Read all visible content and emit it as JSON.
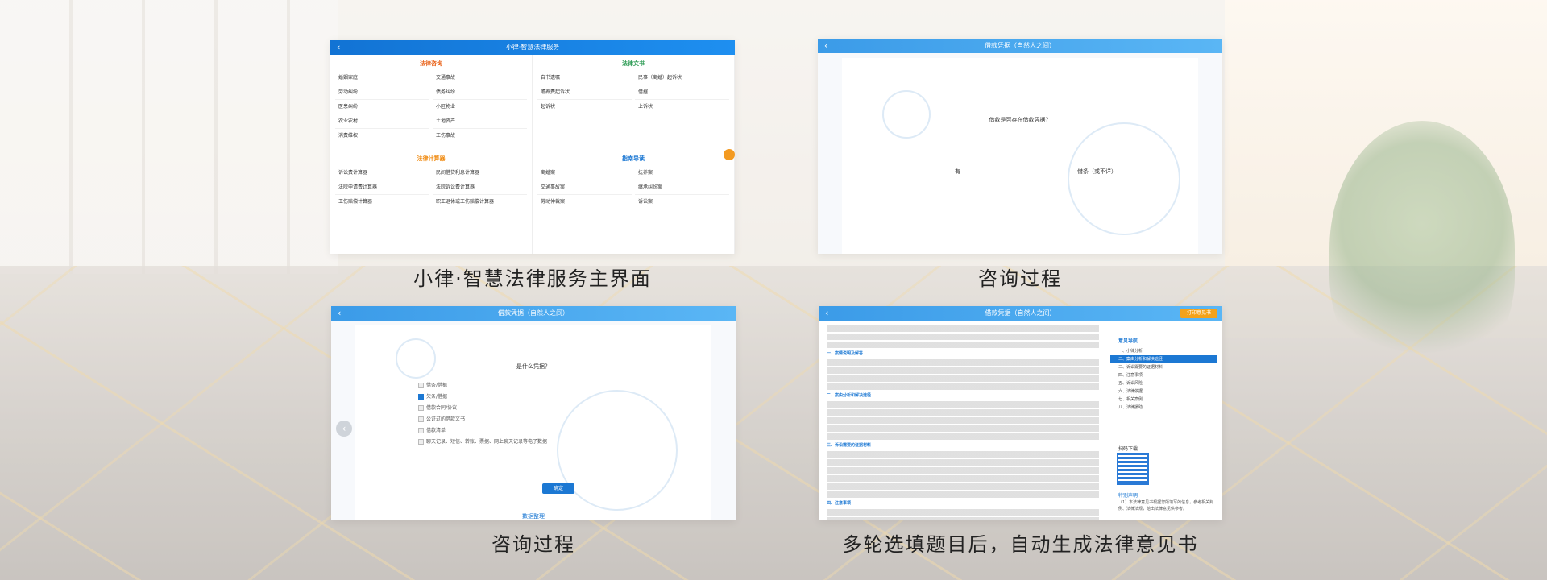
{
  "captions": {
    "p1": "小律·智慧法律服务主界面",
    "p2": "咨询过程",
    "p3": "咨询过程",
    "p4": "多轮选填题目后，自动生成法律意见书"
  },
  "panel1": {
    "title": "小律·智慧法律服务",
    "sections": {
      "consult": {
        "title": "法律咨询",
        "items": [
          "婚姻家庭",
          "交通事故",
          "劳动纠纷",
          "债务纠纷",
          "医患纠纷",
          "小区物业",
          "农业农村",
          "土地资产",
          "消费维权",
          "工伤事故"
        ]
      },
      "docs": {
        "title": "法律文书",
        "items": [
          "自书遗嘱",
          "民事（离婚）起诉状",
          "赡养费起诉状",
          "借据",
          "起诉状",
          "上诉状"
        ]
      },
      "calc": {
        "title": "法律计算器",
        "items": [
          "诉讼费计算器",
          "民间借贷利息计算器",
          "法院申请费计算器",
          "法院诉讼费计算器",
          "工伤赔偿计算器",
          "职工退休或工伤赔偿计算器"
        ]
      },
      "guide": {
        "title": "指南导读",
        "items": [
          "离婚案",
          "抚养案",
          "交通事故案",
          "继承纠纷案",
          "劳动仲裁案",
          "诉讼案"
        ]
      }
    }
  },
  "panel2": {
    "title": "借款凭据（自然人之间）",
    "question": "借款是否存在借款凭据？",
    "option_yes": "有",
    "option_no": "借条（或不详）"
  },
  "panel3": {
    "title": "借款凭据（自然人之间）",
    "question": "是什么凭据？",
    "options": [
      {
        "label": "借条/借据",
        "checked": false
      },
      {
        "label": "欠条/借据",
        "checked": true
      },
      {
        "label": "借款合同/协议",
        "checked": false
      },
      {
        "label": "公证过的借款文书",
        "checked": false
      },
      {
        "label": "借款清单",
        "checked": false
      },
      {
        "label": "聊天记录、短信、转账、票据、网上聊天记录等电子数据",
        "checked": false
      }
    ],
    "confirm": "确定",
    "footer": "数据整理"
  },
  "panel4": {
    "title": "借款凭据（自然人之间）",
    "print_label": "打印意见书",
    "headings": [
      "一、案情说明及解答",
      "二、案由分析和解决途径",
      "三、诉讼需要的证据材料",
      "四、注意事项"
    ],
    "toc_title": "意见导航",
    "toc": [
      "一、小律分析",
      "二、案由分析和解决途径",
      "三、诉讼需要的证据材料",
      "四、注意事项",
      "五、诉讼风险",
      "六、法律依据",
      "七、相关案例",
      "八、法律援助"
    ],
    "toc_active_index": 1,
    "qr_label": "扫码下载",
    "tip_label": "特别声明",
    "tip_text": "（1）本法律意见书根据您所填写的信息，参考相关判例、法律法规，给出法律意见供参考。"
  }
}
